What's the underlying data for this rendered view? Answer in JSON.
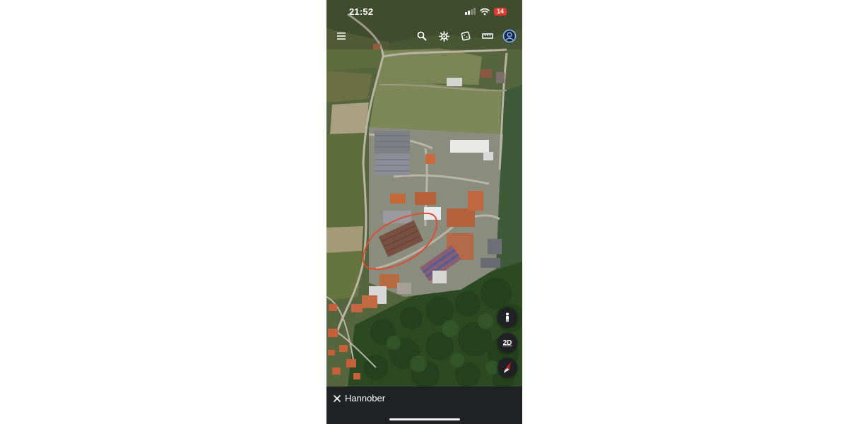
{
  "status_bar": {
    "time": "21:52",
    "signal_bars_active": 2,
    "signal_bars_total": 4,
    "wifi_icon": "wifi-icon",
    "battery_level": "14",
    "battery_color": "#e23a2e"
  },
  "toolbar": {
    "items": [
      {
        "name": "menu-icon"
      },
      {
        "name": "search-icon"
      },
      {
        "name": "voyager-icon"
      },
      {
        "name": "feeling-lucky-dice-icon"
      },
      {
        "name": "measure-ruler-icon"
      },
      {
        "name": "account-icon"
      }
    ]
  },
  "map": {
    "type": "satellite",
    "annotation_color": "#e24a32",
    "annotation_shape": "hand-drawn ellipse"
  },
  "controls": {
    "street_view_icon": "pegman-icon",
    "view_mode_label": "2D",
    "compass_icon": "compass-icon"
  },
  "bottom_bar": {
    "close_icon": "close-icon",
    "place_name": "Hannober"
  },
  "colors": {
    "panel_background": "#202124",
    "text": "#ffffff"
  }
}
